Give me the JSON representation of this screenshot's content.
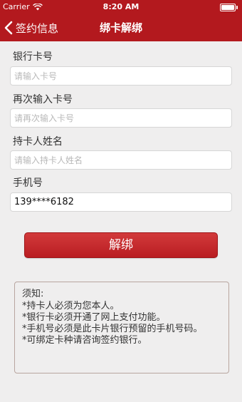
{
  "status_bar": {
    "carrier": "Carrier",
    "time": "8:20 AM"
  },
  "nav": {
    "back_label": "签约信息",
    "title": "绑卡解绑"
  },
  "form": {
    "card_number": {
      "label": "银行卡号",
      "placeholder": "请输入卡号",
      "value": ""
    },
    "card_number_confirm": {
      "label": "再次输入卡号",
      "placeholder": "请再次输入卡号",
      "value": ""
    },
    "holder_name": {
      "label": "持卡人姓名",
      "placeholder": "请输入持卡人姓名",
      "value": ""
    },
    "phone": {
      "label": "手机号",
      "placeholder": "",
      "value": "139****6182"
    }
  },
  "unbind_button": {
    "label": "解绑"
  },
  "notice": {
    "title": "须知:",
    "lines": [
      "*持卡人必须为您本人。",
      "*银行卡必须开通了网上支付功能。",
      "*手机号必须是此卡片银行预留的手机号码。",
      "*可绑定卡种请咨询签约银行。"
    ]
  },
  "colors": {
    "brand": "#b3191e",
    "background": "#efeeee"
  }
}
